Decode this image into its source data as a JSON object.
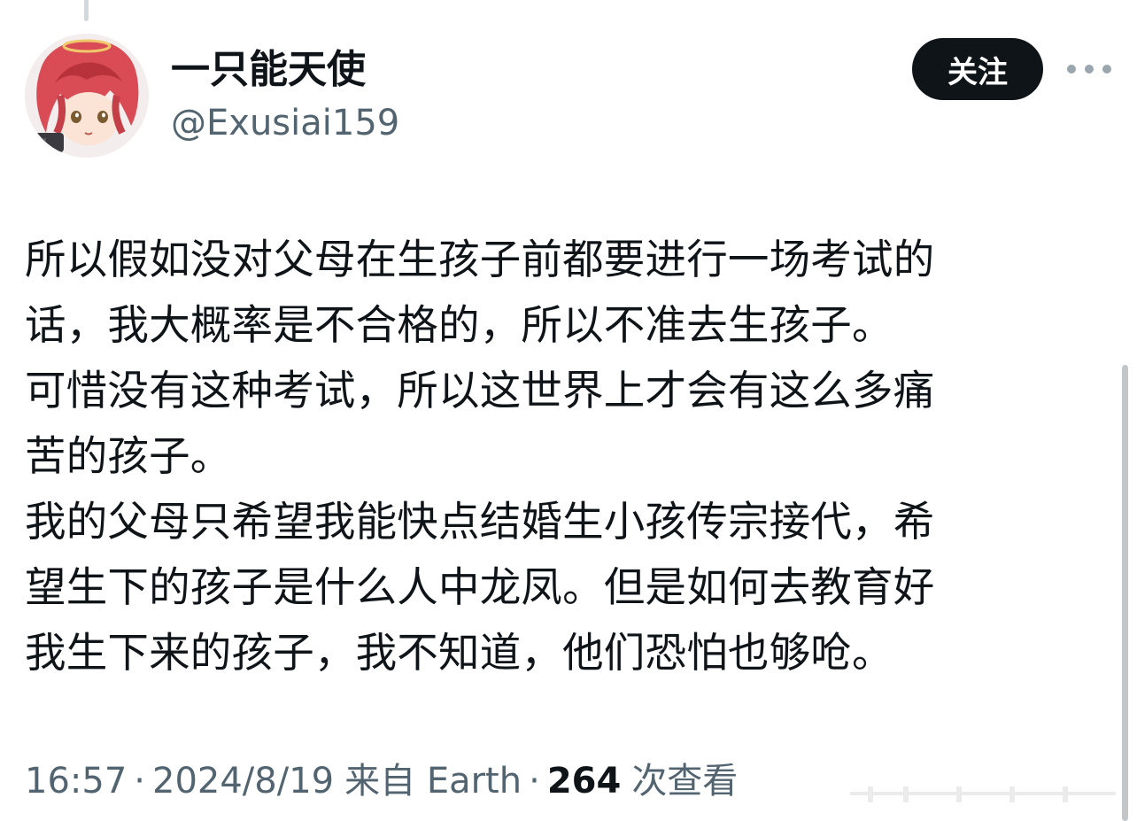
{
  "user": {
    "display_name": "一只能天使",
    "handle": "@Exusiai159",
    "avatar_icon": "anime-avatar-icon"
  },
  "follow_label": "关注",
  "more_icon": "more-dots-icon",
  "tweet": {
    "lines": [
      "所以假如没对父母在生孩子前都要进行一场考试的",
      "话，我大概率是不合格的，所以不准去生孩子。",
      "可惜没有这种考试，所以这世界上才会有这么多痛",
      "苦的孩子。",
      "我的父母只希望我能快点结婚生小孩传宗接代，希",
      "望生下的孩子是什么人中龙凤。但是如何去教育好",
      "我生下来的孩子，我不知道，他们恐怕也够呛。"
    ]
  },
  "meta": {
    "time": "16:57",
    "date": "2024/8/19",
    "source": "来自 Earth",
    "separator": "·",
    "views_count": "264",
    "views_label": "次查看"
  },
  "colors": {
    "text_primary": "#0f1419",
    "text_secondary": "#536471",
    "follow_bg": "#0f1419",
    "follow_text": "#ffffff"
  }
}
